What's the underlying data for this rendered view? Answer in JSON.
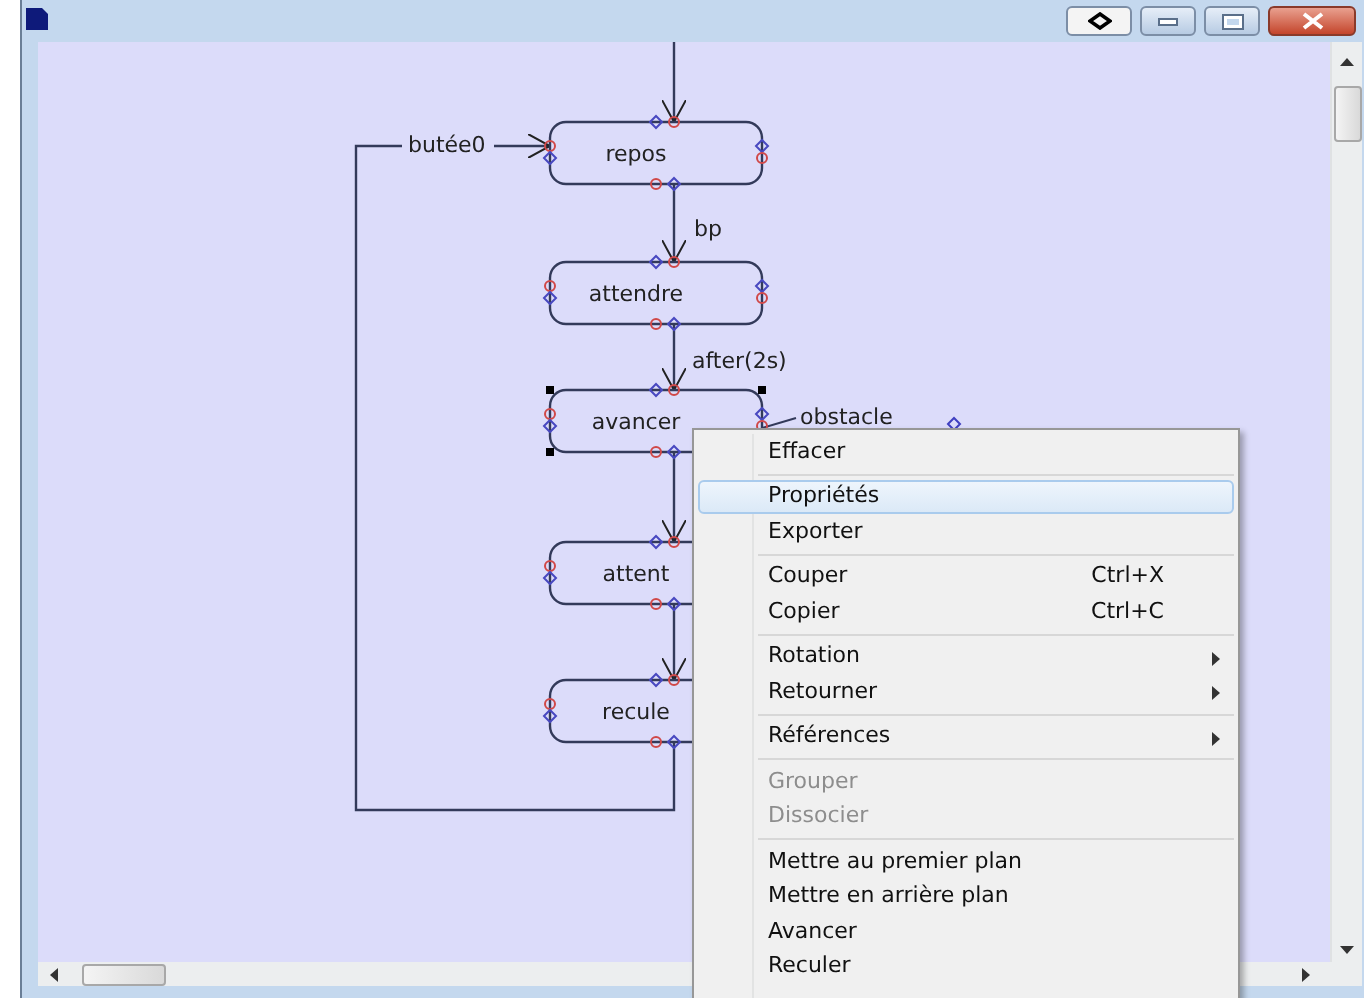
{
  "diagram": {
    "states": [
      {
        "label": "repos",
        "selected": false
      },
      {
        "label": "attendre",
        "selected": false
      },
      {
        "label": "avancer",
        "selected": true
      },
      {
        "label": "attent",
        "selected": false
      },
      {
        "label": "recule",
        "selected": false
      }
    ],
    "transitions": [
      {
        "label": "butée0"
      },
      {
        "label": "bp"
      },
      {
        "label": "after(2s)"
      },
      {
        "label": "obstacle"
      }
    ]
  },
  "context_menu": {
    "items": [
      {
        "kind": "item",
        "label": "Effacer",
        "selected": false,
        "disabled": false
      },
      {
        "kind": "separator"
      },
      {
        "kind": "item",
        "label": "Propriétés",
        "selected": true,
        "disabled": false
      },
      {
        "kind": "item",
        "label": "Exporter",
        "selected": false,
        "disabled": false
      },
      {
        "kind": "separator"
      },
      {
        "kind": "item",
        "label": "Couper",
        "shortcut": "Ctrl+X",
        "selected": false,
        "disabled": false
      },
      {
        "kind": "item",
        "label": "Copier",
        "shortcut": "Ctrl+C",
        "selected": false,
        "disabled": false
      },
      {
        "kind": "separator"
      },
      {
        "kind": "item",
        "label": "Rotation",
        "submenu": true,
        "selected": false,
        "disabled": false
      },
      {
        "kind": "item",
        "label": "Retourner",
        "submenu": true,
        "selected": false,
        "disabled": false
      },
      {
        "kind": "separator"
      },
      {
        "kind": "item",
        "label": "Références",
        "submenu": true,
        "selected": false,
        "disabled": false
      },
      {
        "kind": "separator"
      },
      {
        "kind": "item",
        "label": "Grouper",
        "selected": false,
        "disabled": true
      },
      {
        "kind": "item",
        "label": "Dissocier",
        "selected": false,
        "disabled": true
      },
      {
        "kind": "separator"
      },
      {
        "kind": "item",
        "label": "Mettre au premier plan",
        "selected": false,
        "disabled": false
      },
      {
        "kind": "item",
        "label": "Mettre en arrière plan",
        "selected": false,
        "disabled": false
      },
      {
        "kind": "item",
        "label": "Avancer",
        "selected": false,
        "disabled": false
      },
      {
        "kind": "item",
        "label": "Reculer",
        "selected": false,
        "disabled": false
      }
    ]
  }
}
